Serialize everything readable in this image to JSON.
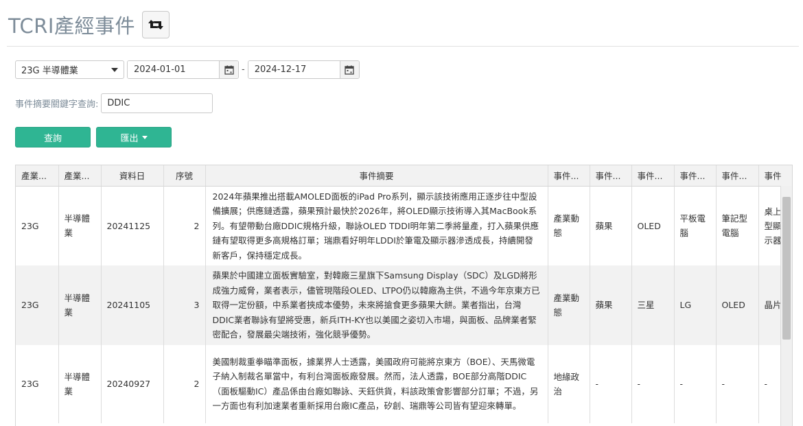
{
  "header": {
    "title": "TCRI產經事件",
    "switch_icon": "retweet-icon"
  },
  "filters": {
    "industry_selected": "23G 半導體業",
    "date_from": "2024-01-01",
    "date_to": "2024-12-17",
    "date_separator": "-",
    "keyword_label": "事件摘要關鍵字查詢:",
    "keyword_value": "DDIC"
  },
  "buttons": {
    "query": "查詢",
    "export": "匯出"
  },
  "table": {
    "columns": [
      "產業...",
      "產業...",
      "資料日",
      "序號",
      "事件摘要",
      "事件...",
      "事件...",
      "事件...",
      "事件...",
      "事件...",
      "事件"
    ],
    "rows": [
      {
        "code": "23G",
        "industry": "半導體業",
        "date": "20241125",
        "seq": "2",
        "summary": "2024年蘋果推出搭載AMOLED面板的iPad Pro系列，顯示該技術應用正逐步往中型設備擴展；供應鏈透露，蘋果預計最快於2026年，將OLED顯示技術導入其MacBook系列。有望帶動台廠DDIC規格升級，聯詠OLED TDDI明年第二季將量產，打入蘋果供應鏈有望取得更多高規格訂單；瑞鼎看好明年LDDI於筆電及顯示器滲透成長，持續開發新客戶，保持穩定成長。",
        "e1": "產業動態",
        "e2": "蘋果",
        "e3": "OLED",
        "e4": "平板電腦",
        "e5": "筆記型電腦",
        "e6": "桌上型顯示器"
      },
      {
        "code": "23G",
        "industry": "半導體業",
        "date": "20241105",
        "seq": "3",
        "summary": "蘋果於中國建立面板實驗室，對韓廠三星旗下Samsung Display（SDC）及LGD將形成強力威脅，業者表示，儘管現階段OLED、LTPO仍以韓廠為主供，不過今年京東方已取得一定份額，中系業者挾成本優勢，未來將搶食更多蘋果大餅。業者指出，台灣DDIC業者聯詠有望將受惠，新兵ITH-KY也以美國之姿切入市場，與面板、品牌業者緊密配合，發展最尖端技術，強化競爭優勢。",
        "e1": "產業動態",
        "e2": "蘋果",
        "e3": "三星",
        "e4": "LG",
        "e5": "OLED",
        "e6": "晶片"
      },
      {
        "code": "23G",
        "industry": "半導體業",
        "date": "20240927",
        "seq": "2",
        "summary": "美國制裁重拳瞄準面板，據業界人士透露，美國政府可能將京東方（BOE）、天馬微電子納入制裁名單當中，有利台灣面板廠發展。然而，法人透露，BOE部分高階DDIC（面板驅動IC）產品係由台廠如聯詠、天鈺供貨，料該政策會影響部分訂單；不過，另一方面也有利加速業者重新採用台廠IC產品，矽創、瑞鼎等公司皆有望迎來轉單。",
        "e1": "地緣政治",
        "e2": "-",
        "e3": "-",
        "e4": "-",
        "e5": "-",
        "e6": "-"
      }
    ]
  }
}
